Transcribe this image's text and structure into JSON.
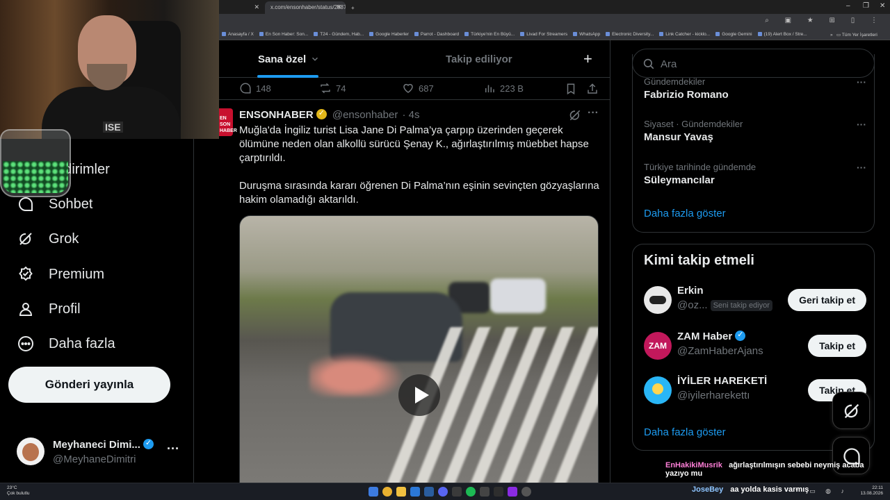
{
  "browser": {
    "tabs": [
      {
        "label": "",
        "active": false
      },
      {
        "label": "x.com/ensonhaber/status/2087",
        "active": true
      }
    ],
    "new_tab": "+",
    "window_controls": [
      "–",
      "❐",
      "✕"
    ],
    "bookmarks": [
      "Anasayfa / X",
      "En Son Haber: Son...",
      "T24 - Gündem, Hab...",
      "Google Haberler",
      "Parrot - Dashboard",
      "Türkiye'nin En Büyü...",
      "Livad For Streamers",
      "WhatsApp",
      "Electronic Diversity...",
      "Link Catcher - kicklo...",
      "Google Gemini",
      "(19) Alert Box / Stre..."
    ],
    "bookmarks_more": "»",
    "bookmarks_all": "Tüm Yer İşaretleri"
  },
  "webcam": {
    "shirt_text": "ISE"
  },
  "nav": {
    "items": [
      {
        "label": "Bildirimler",
        "icon": "bell-icon"
      },
      {
        "label": "Sohbet",
        "icon": "chat-icon"
      },
      {
        "label": "Grok",
        "icon": "grok-icon"
      },
      {
        "label": "Premium",
        "icon": "premium-icon"
      },
      {
        "label": "Profil",
        "icon": "profile-icon"
      },
      {
        "label": "Daha fazla",
        "icon": "more-circle-icon"
      }
    ],
    "post_button": "Gönderi yayınla",
    "profile": {
      "name": "Meyhaneci Dimi...",
      "handle": "@MeyhaneDimitri",
      "more": "···"
    }
  },
  "main": {
    "tabs": [
      {
        "label": "Sana özel",
        "active": true
      },
      {
        "label": "Takip ediliyor",
        "active": false
      }
    ],
    "add": "+",
    "prev_actions": {
      "replies": "148",
      "reposts": "74",
      "likes": "687",
      "views": "223 B"
    },
    "tweet": {
      "avatar_text": "EN\nSON\nHABER",
      "name": "ENSONHABER",
      "handle": "@ensonhaber",
      "time": "· 4s",
      "more": "···",
      "paragraphs": [
        "Muğla'da İngiliz turist Lisa Jane Di Palma’ya çarpıp üzerinden geçerek ölümüne neden olan alkollü sürücü Şenay K., ağırlaştırılmış müebbet hapse çarptırıldı.",
        "Duruşma sırasında kararı öğrenen Di Palma’nın eşinin sevinçten gözyaşlarına hakim olamadığı aktarıldı."
      ]
    }
  },
  "right": {
    "search_placeholder": "Ara",
    "trends": [
      {
        "context": "Gündemdekiler",
        "title": "Fabrizio Romano"
      },
      {
        "context": "Siyaset · Gündemdekiler",
        "title": "Mansur Yavaş"
      },
      {
        "context": "Türkiye tarihinde gündemde",
        "title": "Süleymancılar"
      }
    ],
    "trends_more": "Daha fazla göster",
    "who_title": "Kimi takip etmeli",
    "who": [
      {
        "name": "Erkin",
        "handle": "@oz...",
        "badge": "Seni takip ediyor",
        "button": "Geri takip et",
        "verified": false
      },
      {
        "name": "ZAM Haber",
        "handle": "@ZamHaberAjans",
        "badge": "",
        "button": "Takip et",
        "verified": true,
        "avatar_text": "ZAM"
      },
      {
        "name": "İYİLER HAREKETİ",
        "handle": "@iyilerharekettı",
        "badge": "",
        "button": "Takip et",
        "verified": false
      }
    ],
    "who_more": "Daha fazla göster"
  },
  "chat": [
    {
      "user": "EnHakikiMusrik",
      "message": "ağırlaştırılmışın sebebi neymiş acaba yazıyo mu"
    },
    {
      "user": "JoseBey",
      "message": "aa yolda kasis varmış"
    }
  ],
  "taskbar": {
    "weather_temp": "23°C",
    "weather_desc": "Çok bulutlu",
    "time": "22:11",
    "date": "13.08.2026"
  },
  "colors": {
    "accent": "#1d9bf0",
    "background": "#000000",
    "border": "#2f3336",
    "muted": "#71767b",
    "chat_user1": "#ff7fd8",
    "chat_user2": "#8ec5ff"
  }
}
